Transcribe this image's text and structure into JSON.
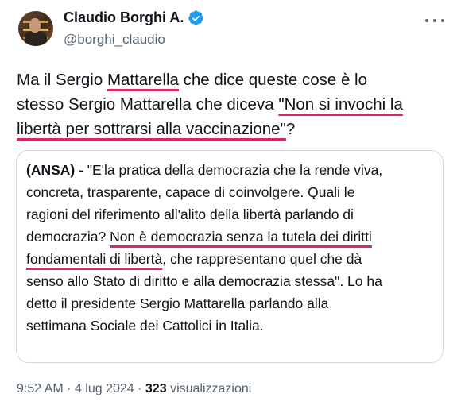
{
  "author": {
    "name": "Claudio Borghi A.",
    "handle": "@borghi_claudio",
    "verified_color": "#1d9bf0"
  },
  "tweet": {
    "line1": [
      "Ma il Sergio ",
      "Mattarella",
      " che dice queste cose è lo"
    ],
    "line2": [
      "stesso Sergio Mattarella che diceva ",
      "\"Non si invochi la"
    ],
    "line3": [
      "libertà per sottrarsi alla vaccinazione\"",
      "?"
    ],
    "underline_color": "#e0245e"
  },
  "quote": {
    "source": "(ANSA)",
    "line1": " - \"E'la pratica della democrazia che la rende viva,",
    "line2": "concreta, trasparente, capace di coinvolgere. Quali le",
    "line3": "ragioni del riferimento all'alito della libertà parlando di",
    "line4a": "democrazia? ",
    "line4b": "Non è democrazia senza la tutela dei diritti",
    "line5a": "fondamentali di libertà",
    "line5b": ", che rappresentano quel che dà",
    "line6": "senso allo Stato di diritto e alla democrazia stessa\". Lo ha",
    "line7": "detto il presidente Sergio Mattarella parlando alla",
    "line8": "settimana Sociale dei Cattolici in Italia."
  },
  "meta": {
    "time": "9:52 AM",
    "date": "4 lug 2024",
    "views_count": "323",
    "views_label": "visualizzazioni",
    "separator": "·"
  }
}
